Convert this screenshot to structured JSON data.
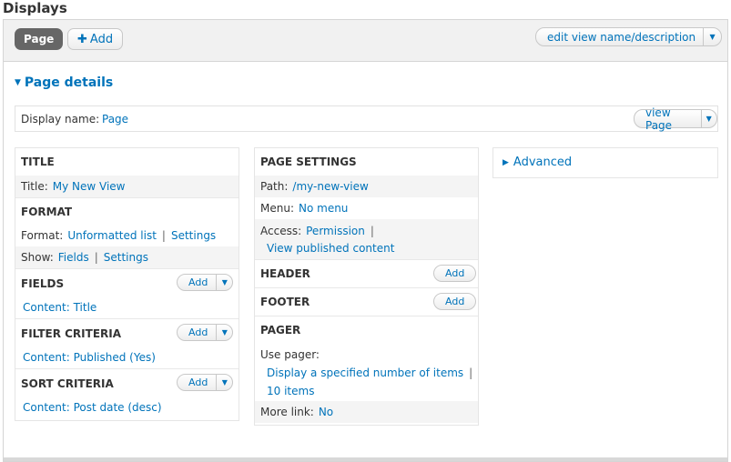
{
  "displays_title": "Displays",
  "tabs": {
    "page_label": "Page",
    "add_label": "Add",
    "edit_view_label": "edit view name/description"
  },
  "page_details": {
    "toggle_label": "Page details",
    "display_name_label": "Display name:",
    "display_name_value": "Page",
    "view_page_label": "view Page"
  },
  "col1": {
    "title_head": "TITLE",
    "title_label": "Title:",
    "title_value": "My New View",
    "format_head": "FORMAT",
    "format_label": "Format:",
    "format_value": "Unformatted list",
    "format_settings": "Settings",
    "show_label": "Show:",
    "show_value": "Fields",
    "show_settings": "Settings",
    "fields_head": "FIELDS",
    "fields_item": "Content: Title",
    "filter_head": "FILTER CRITERIA",
    "filter_item": "Content: Published (Yes)",
    "sort_head": "SORT CRITERIA",
    "sort_item": "Content: Post date (desc)",
    "add_label": "Add"
  },
  "col2": {
    "page_settings_head": "PAGE SETTINGS",
    "path_label": "Path:",
    "path_value": "/my-new-view",
    "menu_label": "Menu:",
    "menu_value": "No menu",
    "access_label": "Access:",
    "access_value": "Permission",
    "access_value2": "View published content",
    "header_head": "HEADER",
    "footer_head": "FOOTER",
    "pager_head": "PAGER",
    "use_pager_label": "Use pager:",
    "use_pager_value": "Display a specified number of items",
    "use_pager_value2": "10 items",
    "more_link_label": "More link:",
    "more_link_value": "No",
    "add_label": "Add"
  },
  "col3": {
    "advanced_label": "Advanced"
  },
  "separator": "|",
  "icons": {
    "caret_down": "chevron-down-icon",
    "triangle_down": "triangle-down-icon",
    "triangle_right": "triangle-right-icon",
    "plus": "plus-icon"
  },
  "colors": {
    "link": "#0073ba",
    "tab_active_bg": "#666666"
  }
}
